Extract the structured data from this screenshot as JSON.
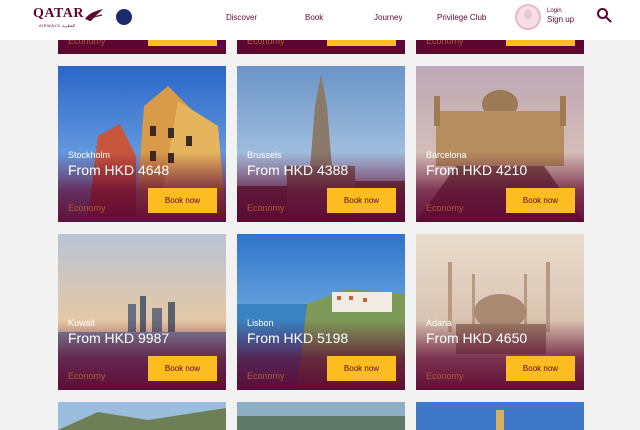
{
  "header": {
    "logo_text": "QATAR",
    "logo_sub": "AIRWAYS القطرية",
    "nav": [
      "Discover",
      "Book",
      "Journey",
      "Privilege Club"
    ],
    "login": "Login",
    "signup": "Sign up"
  },
  "cards": [
    {
      "city": "Stockholm",
      "price": "From HKD 4648",
      "cabin": "Economy",
      "cta": "Book now"
    },
    {
      "city": "Brussels",
      "price": "From HKD 4388",
      "cabin": "Economy",
      "cta": "Book now"
    },
    {
      "city": "Barcelona",
      "price": "From HKD 4210",
      "cabin": "Economy",
      "cta": "Book now"
    },
    {
      "city": "Kuwait",
      "price": "From HKD 9987",
      "cabin": "Economy",
      "cta": "Book now"
    },
    {
      "city": "Lisbon",
      "price": "From HKD 5198",
      "cabin": "Economy",
      "cta": "Book now"
    },
    {
      "city": "Adana",
      "price": "From HKD 4650",
      "cabin": "Economy",
      "cta": "Book now"
    }
  ],
  "top_row_cabin": "Economy",
  "colors": {
    "brand": "#5c0632",
    "accent": "#fdbc20",
    "economy": "#b05a2e"
  }
}
